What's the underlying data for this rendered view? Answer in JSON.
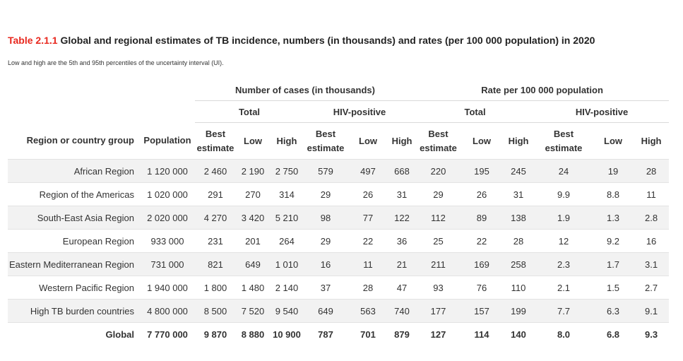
{
  "title": {
    "number": "Table 2.1.1",
    "text": "Global and regional estimates of TB incidence, numbers (in thousands) and rates (per 100 000 population) in 2020"
  },
  "subtitle": "Low and high are the 5th and 95th percentiles of the uncertainty interval (UI).",
  "header": {
    "group_cases": "Number of cases (in thousands)",
    "group_rate": "Rate per 100 000 population",
    "sub_total": "Total",
    "sub_hiv": "HIV-positive",
    "col_region": "Region or country group",
    "col_population": "Population",
    "best_line1": "Best",
    "best_line2": "estimate",
    "low": "Low",
    "high": "High"
  },
  "rows": [
    {
      "region": "African Region",
      "population": "1 120 000",
      "cases_total": [
        "2 460",
        "2 190",
        "2 750"
      ],
      "cases_hiv": [
        "579",
        "497",
        "668"
      ],
      "rate_total": [
        "220",
        "195",
        "245"
      ],
      "rate_hiv": [
        "24",
        "19",
        "28"
      ]
    },
    {
      "region": "Region of the Americas",
      "population": "1 020 000",
      "cases_total": [
        "291",
        "270",
        "314"
      ],
      "cases_hiv": [
        "29",
        "26",
        "31"
      ],
      "rate_total": [
        "29",
        "26",
        "31"
      ],
      "rate_hiv": [
        "9.9",
        "8.8",
        "11"
      ]
    },
    {
      "region": "South-East Asia Region",
      "population": "2 020 000",
      "cases_total": [
        "4 270",
        "3 420",
        "5 210"
      ],
      "cases_hiv": [
        "98",
        "77",
        "122"
      ],
      "rate_total": [
        "112",
        "89",
        "138"
      ],
      "rate_hiv": [
        "1.9",
        "1.3",
        "2.8"
      ]
    },
    {
      "region": "European Region",
      "population": "933 000",
      "cases_total": [
        "231",
        "201",
        "264"
      ],
      "cases_hiv": [
        "29",
        "22",
        "36"
      ],
      "rate_total": [
        "25",
        "22",
        "28"
      ],
      "rate_hiv": [
        "12",
        "9.2",
        "16"
      ]
    },
    {
      "region": "Eastern Mediterranean Region",
      "population": "731 000",
      "cases_total": [
        "821",
        "649",
        "1 010"
      ],
      "cases_hiv": [
        "16",
        "11",
        "21"
      ],
      "rate_total": [
        "211",
        "169",
        "258"
      ],
      "rate_hiv": [
        "2.3",
        "1.7",
        "3.1"
      ]
    },
    {
      "region": "Western Pacific Region",
      "population": "1 940 000",
      "cases_total": [
        "1 800",
        "1 480",
        "2 140"
      ],
      "cases_hiv": [
        "37",
        "28",
        "47"
      ],
      "rate_total": [
        "93",
        "76",
        "110"
      ],
      "rate_hiv": [
        "2.1",
        "1.5",
        "2.7"
      ]
    },
    {
      "region": "High TB burden countries",
      "population": "4 800 000",
      "cases_total": [
        "8 500",
        "7 520",
        "9 540"
      ],
      "cases_hiv": [
        "649",
        "563",
        "740"
      ],
      "rate_total": [
        "177",
        "157",
        "199"
      ],
      "rate_hiv": [
        "7.7",
        "6.3",
        "9.1"
      ]
    },
    {
      "region": "Global",
      "population": "7 770 000",
      "cases_total": [
        "9 870",
        "8 880",
        "10 900"
      ],
      "cases_hiv": [
        "787",
        "701",
        "879"
      ],
      "rate_total": [
        "127",
        "114",
        "140"
      ],
      "rate_hiv": [
        "8.0",
        "6.8",
        "9.3"
      ]
    }
  ],
  "colors": {
    "accent": "#e8281e",
    "row_alt": "#f2f2f2",
    "rule": "#d9d9d9"
  }
}
